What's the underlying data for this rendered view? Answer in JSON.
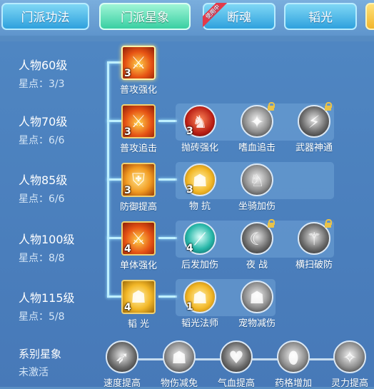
{
  "tabs": [
    {
      "label": "门派功法"
    },
    {
      "label": "门派星象"
    },
    {
      "label": "断魂",
      "ribbon": "使用中"
    },
    {
      "label": "韬光"
    }
  ],
  "rows": [
    {
      "level": "人物60级",
      "points": "星点：3/3"
    },
    {
      "level": "人物70级",
      "points": "星点：6/6"
    },
    {
      "level": "人物85级",
      "points": "星点：6/6"
    },
    {
      "level": "人物100级",
      "points": "星点：8/8"
    },
    {
      "level": "人物115级",
      "points": "星点：5/8"
    }
  ],
  "skills": {
    "r1a": {
      "name": "普攻强化",
      "count": "3",
      "icon": "sword-fire-icon"
    },
    "r2a": {
      "name": "普攻追击",
      "count": "3",
      "icon": "sword-fire-icon"
    },
    "r2b": {
      "name": "抛砖强化",
      "count": "3",
      "icon": "warrior-red-icon"
    },
    "r2c": {
      "name": "嗜血追击",
      "count": "",
      "icon": "beast-claw-icon",
      "locked": true
    },
    "r2d": {
      "name": "武器神通",
      "count": "",
      "icon": "weapon-slash-icon",
      "locked": true
    },
    "r3a": {
      "name": "防御提高",
      "count": "3",
      "icon": "shield-fire-icon"
    },
    "r3b": {
      "name": "物 抗",
      "count": "3",
      "icon": "golden-figure-icon"
    },
    "r3c": {
      "name": "坐骑加伤",
      "count": "",
      "icon": "mount-beast-icon"
    },
    "r4a": {
      "name": "单体强化",
      "count": "4",
      "icon": "sword-fire-icon"
    },
    "r4b": {
      "name": "后发加伤",
      "count": "4",
      "icon": "blade-aqua-icon"
    },
    "r4c": {
      "name": "夜 战",
      "count": "",
      "icon": "night-warrior-icon",
      "locked": true
    },
    "r4d": {
      "name": "横扫破防",
      "count": "",
      "icon": "sweep-warrior-icon",
      "locked": true
    },
    "r5a": {
      "name": "韬 光",
      "count": "4",
      "icon": "golden-figure-icon"
    },
    "r5b": {
      "name": "韬光法师",
      "count": "1",
      "icon": "golden-figure-icon"
    },
    "r5c": {
      "name": "宠物减伤",
      "count": "",
      "icon": "grey-figure-icon"
    }
  },
  "series": {
    "title": "系别星象",
    "status": "未激活",
    "items": [
      {
        "name": "速度提高",
        "icon": "speed-icon"
      },
      {
        "name": "物伤减免",
        "icon": "guard-figure-icon"
      },
      {
        "name": "气血提高",
        "icon": "heart-icon"
      },
      {
        "name": "药格增加",
        "icon": "potion-icon"
      },
      {
        "name": "灵力提高",
        "icon": "spirit-icon"
      }
    ]
  }
}
